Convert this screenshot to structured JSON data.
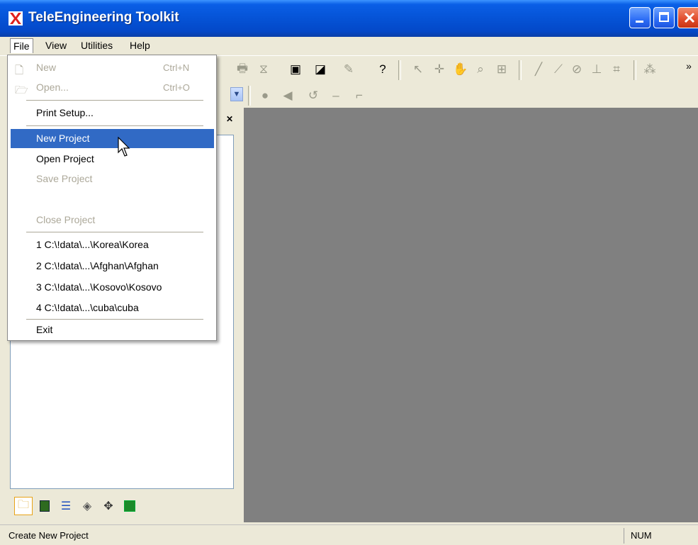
{
  "window": {
    "title": "TeleEngineering Toolkit"
  },
  "menubar": {
    "items": [
      "File",
      "View",
      "Utilities",
      "Help"
    ]
  },
  "file_menu": {
    "new": {
      "label": "New",
      "shortcut": "Ctrl+N"
    },
    "open": {
      "label": "Open...",
      "shortcut": "Ctrl+O"
    },
    "print_setup": "Print Setup...",
    "new_project": "New Project",
    "open_project": "Open Project",
    "save_project": "Save Project",
    "close_project": "Close Project",
    "recent": [
      "1 C:\\!data\\...\\Korea\\Korea",
      "2 C:\\!data\\...\\Afghan\\Afghan",
      "3 C:\\!data\\...\\Kosovo\\Kosovo",
      "4 C:\\!data\\...\\cuba\\cuba"
    ],
    "exit": "Exit"
  },
  "statusbar": {
    "message": "Create New Project",
    "num": "NUM"
  },
  "colors": {
    "titlebar": "#0553d6",
    "highlight": "#316ac5",
    "workspace": "#808080",
    "disabled": "#aca899"
  }
}
